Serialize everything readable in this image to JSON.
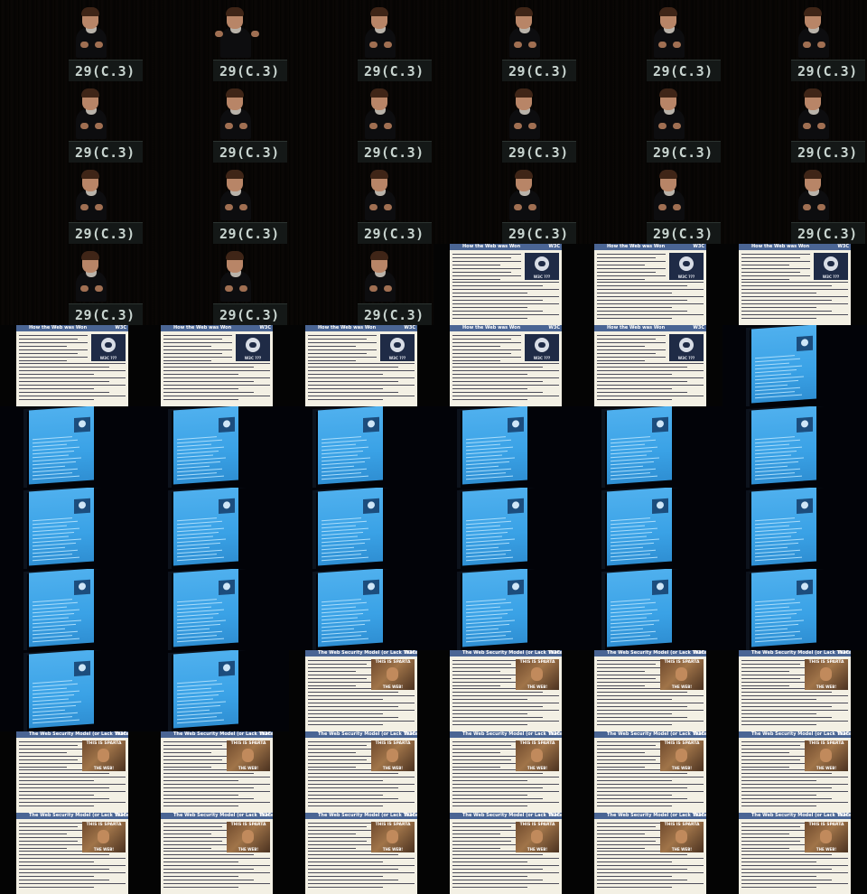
{
  "podium_label": "29(C.3)",
  "slide_a": {
    "title": "How the Web was Won",
    "brand": "W3C",
    "badge_caption": "W3C ???"
  },
  "slide_b": {
    "title": "The Web Security Model (or Lack Thereof)",
    "brand": "W3C",
    "meme_top": "THIS IS SPARTA",
    "meme_bottom": "THE WEB!"
  },
  "grid": {
    "columns": 6,
    "rows": 11
  },
  "frames": [
    "speaker",
    "speaker-gesture",
    "speaker",
    "speaker",
    "speaker",
    "speaker",
    "speaker",
    "speaker",
    "speaker",
    "speaker",
    "speaker",
    "speaker",
    "speaker",
    "speaker",
    "speaker",
    "speaker",
    "speaker",
    "speaker",
    "speaker",
    "speaker",
    "speaker",
    "slide-a",
    "slide-a",
    "slide-a",
    "slide-a",
    "slide-a",
    "slide-a",
    "slide-a",
    "slide-a",
    "projected",
    "projected",
    "projected",
    "projected",
    "projected",
    "projected",
    "projected",
    "projected",
    "projected",
    "projected",
    "projected",
    "projected",
    "projected",
    "projected",
    "projected",
    "projected",
    "projected",
    "projected",
    "projected",
    "projected",
    "projected-b",
    "slide-b",
    "slide-b",
    "slide-b",
    "slide-b",
    "slide-b",
    "slide-b",
    "slide-b",
    "slide-b",
    "slide-b",
    "slide-b",
    "slide-b",
    "slide-b",
    "slide-b",
    "slide-b",
    "slide-b",
    "slide-b"
  ]
}
